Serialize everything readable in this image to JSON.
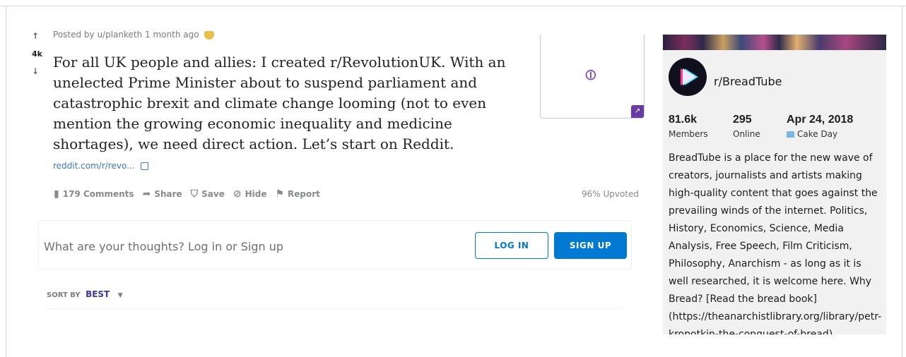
{
  "post": {
    "vote_up": "↑",
    "vote_count": "4k",
    "vote_down": "↓",
    "meta": "Posted by u/planketh 1 month ago",
    "title": "For all UK people and allies: I created r/RevolutionUK. With an unelected Prime Minister about to suspend parliament and catastrophic brexit and climate change looming (not to even mention the growing economic inequality and medicine shortages), we need direct action. Let’s start on Reddit.",
    "link_text": "reddit.com/r/revo...",
    "actions": {
      "comments": "179 Comments",
      "share": "Share",
      "save": "Save",
      "hide": "Hide",
      "report": "Report"
    },
    "upvoted": "96% Upvoted"
  },
  "comment_box": {
    "placeholder": "What are your thoughts? Log in or Sign up",
    "login_label": "LOG IN",
    "signup_label": "SIGN UP"
  },
  "sort": {
    "label": "SORT BY",
    "value": "BEST"
  },
  "sidebar": {
    "subreddit": "r/BreadTube",
    "members_value": "81.6k",
    "members_label": "Members",
    "online_value": "295",
    "online_label": "Online",
    "cakeday_value": "Apr 24, 2018",
    "cakeday_label": "Cake Day",
    "description": "BreadTube is a place for the new wave of creators, journalists and artists making high-quality content that goes against the prevailing winds of the internet. Politics, History, Economics, Science, Media Analysis, Free Speech, Film Criticism, Philosophy, Anarchism - as long as it is well researched, it is welcome here. Why Bread? [Read the bread book] (https://theanarchistlibrary.org/library/petr-kropotkin-the-conquest-of-bread)"
  },
  "colors": {
    "accent_blue": "#0079d3",
    "link_purple": "#7b3fb5"
  }
}
